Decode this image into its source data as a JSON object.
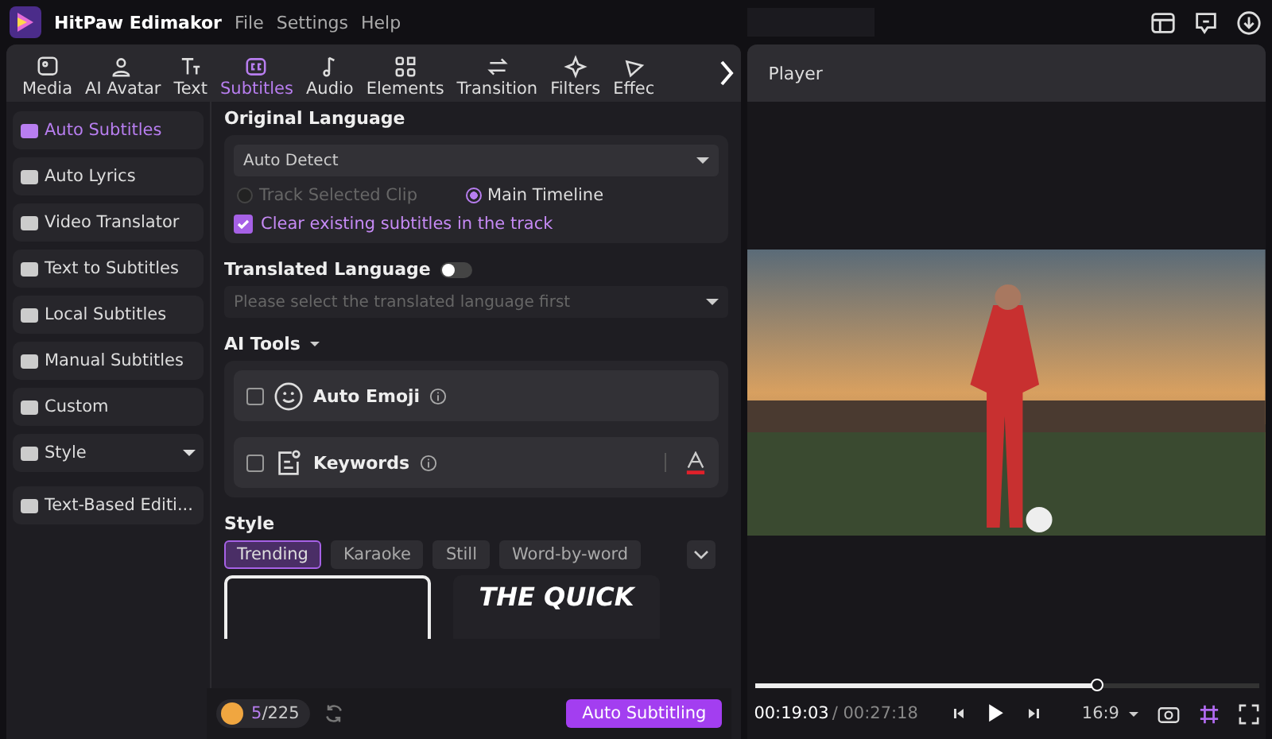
{
  "app": {
    "title": "HitPaw Edimakor",
    "menu": [
      "File",
      "Settings",
      "Help"
    ]
  },
  "toolbar_tabs": [
    {
      "label": "Media",
      "selected": false
    },
    {
      "label": "AI Avatar",
      "selected": false
    },
    {
      "label": "Text",
      "selected": false
    },
    {
      "label": "Subtitles",
      "selected": true
    },
    {
      "label": "Audio",
      "selected": false
    },
    {
      "label": "Elements",
      "selected": false
    },
    {
      "label": "Transition",
      "selected": false
    },
    {
      "label": "Filters",
      "selected": false
    },
    {
      "label": "Effec",
      "selected": false
    }
  ],
  "sidebar": {
    "items": [
      {
        "label": "Auto Subtitles",
        "selected": true,
        "dropdown": false
      },
      {
        "label": "Auto Lyrics",
        "selected": false,
        "dropdown": false
      },
      {
        "label": "Video Translator",
        "selected": false,
        "dropdown": false
      },
      {
        "label": "Text to Subtitles",
        "selected": false,
        "dropdown": false
      },
      {
        "label": "Local Subtitles",
        "selected": false,
        "dropdown": false
      },
      {
        "label": "Manual Subtitles",
        "selected": false,
        "dropdown": false
      },
      {
        "label": "Custom",
        "selected": false,
        "dropdown": false
      },
      {
        "label": "Style",
        "selected": false,
        "dropdown": true
      },
      {
        "label": "Text-Based Editi...",
        "selected": false,
        "dropdown": false
      }
    ]
  },
  "original_language": {
    "heading": "Original Language",
    "value": "Auto Detect",
    "scope": [
      {
        "label": "Track Selected Clip",
        "selected": false,
        "disabled": true
      },
      {
        "label": "Main Timeline",
        "selected": true,
        "disabled": false
      }
    ],
    "clear_existing": {
      "label": "Clear existing subtitles in the track",
      "checked": true
    }
  },
  "translated_language": {
    "heading": "Translated Language",
    "on": false,
    "placeholder": "Please select the translated language first"
  },
  "ai_tools": {
    "heading": "AI Tools",
    "items": [
      {
        "label": "Auto Emoji",
        "kind": "emoji",
        "checked": false
      },
      {
        "label": "Keywords",
        "kind": "keywords",
        "checked": false
      }
    ]
  },
  "style": {
    "heading": "Style",
    "tabs": [
      {
        "label": "Trending",
        "selected": true
      },
      {
        "label": "Karaoke",
        "selected": false
      },
      {
        "label": "Still",
        "selected": false
      },
      {
        "label": "Word-by-word",
        "selected": false
      }
    ],
    "preview_text": "THE QUICK"
  },
  "footer": {
    "credits_used": "5",
    "credits_total": "/225",
    "button": "Auto Subtitling"
  },
  "player": {
    "title": "Player",
    "current_time": "00:19:03",
    "total_time": "/ 00:27:18",
    "level": 0.68,
    "aspect": "16:9"
  }
}
